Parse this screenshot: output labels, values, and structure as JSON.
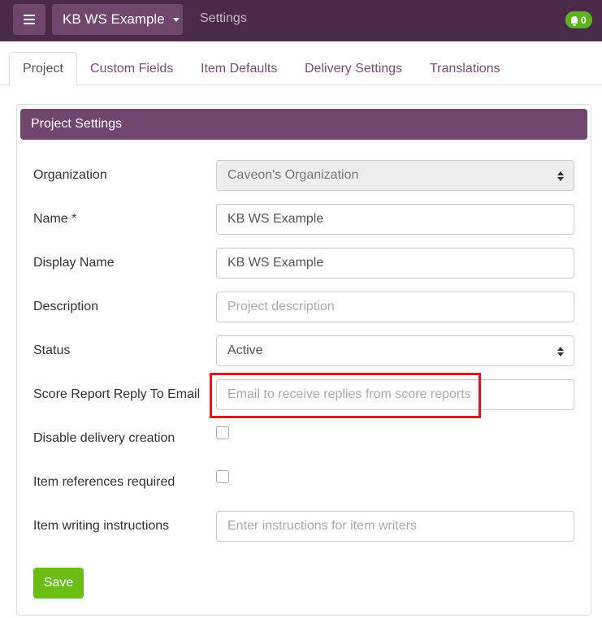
{
  "header": {
    "menu_icon": "hamburger-icon",
    "project_name": "KB WS Example",
    "breadcrumb": "Settings",
    "notification_count": "0",
    "notification_icon": "bell-icon",
    "notification_color": "#5cb21c",
    "bar_color": "#4b2a49",
    "accent_color": "#70466e"
  },
  "tabs": [
    {
      "label": "Project",
      "active": true
    },
    {
      "label": "Custom Fields",
      "active": false
    },
    {
      "label": "Item Defaults",
      "active": false
    },
    {
      "label": "Delivery Settings",
      "active": false
    },
    {
      "label": "Translations",
      "active": false
    }
  ],
  "panel": {
    "title": "Project Settings"
  },
  "form": {
    "organization": {
      "label": "Organization",
      "value": "Caveon's Organization",
      "disabled": true
    },
    "name": {
      "label": "Name *",
      "value": "KB WS Example"
    },
    "display_name": {
      "label": "Display Name",
      "value": "KB WS Example"
    },
    "description": {
      "label": "Description",
      "value": "",
      "placeholder": "Project description"
    },
    "status": {
      "label": "Status",
      "value": "Active"
    },
    "score_report_email": {
      "label": "Score Report Reply To Email",
      "value": "",
      "placeholder": "Email to receive replies from score reports"
    },
    "disable_delivery": {
      "label": "Disable delivery creation",
      "checked": false
    },
    "item_references": {
      "label": "Item references required",
      "checked": false
    },
    "writing_instructions": {
      "label": "Item writing instructions",
      "value": "",
      "placeholder": "Enter instructions for item writers"
    },
    "save_label": "Save",
    "save_color": "#6bbd14",
    "highlight_color": "#e5121b"
  }
}
